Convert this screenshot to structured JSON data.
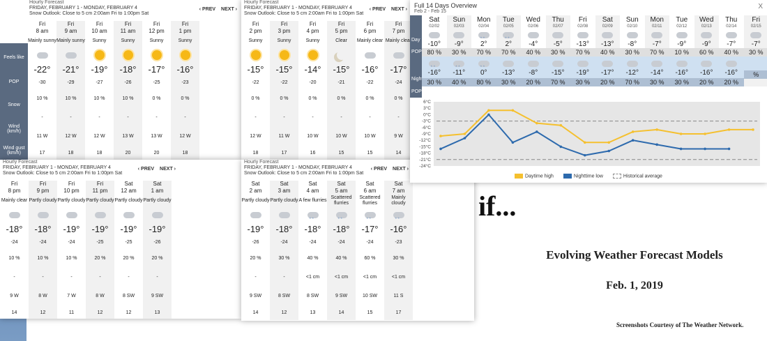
{
  "hourly_panels": [
    {
      "title": "Hourly Forecast",
      "range": "FRIDAY, FEBRUARY 1 - MONDAY, FEBRUARY 4",
      "outlook": "Snow Outlook: Close to 5 cm 2:00am Fri to 1:00pm Sat",
      "prev": "PREV",
      "next": "NEXT",
      "show_labels": true,
      "labels": [
        "Feels like",
        "POP",
        "Snow",
        "Wind (km/h)",
        "Wind gust (km/h)"
      ],
      "columns": [
        {
          "day": "Fri",
          "hour": "8 am",
          "cond": "Mainly sunny",
          "icon": "sun-cloud-icon",
          "temp": "-22°",
          "feels": "-30",
          "pop": "10 %",
          "snow": "-",
          "wind": "11 W",
          "gust": "17"
        },
        {
          "day": "Fri",
          "hour": "9 am",
          "cond": "Mainly sunny",
          "icon": "sun-cloud-icon",
          "temp": "-21°",
          "feels": "-29",
          "pop": "10 %",
          "snow": "-",
          "wind": "12 W",
          "gust": "18"
        },
        {
          "day": "Fri",
          "hour": "10 am",
          "cond": "Sunny",
          "icon": "sun-icon",
          "temp": "-19°",
          "feels": "-27",
          "pop": "10 %",
          "snow": "-",
          "wind": "12 W",
          "gust": "18"
        },
        {
          "day": "Fri",
          "hour": "11 am",
          "cond": "Sunny",
          "icon": "sun-icon",
          "temp": "-18°",
          "feels": "-26",
          "pop": "10 %",
          "snow": "-",
          "wind": "13 W",
          "gust": "20"
        },
        {
          "day": "Fri",
          "hour": "12 pm",
          "cond": "Sunny",
          "icon": "sun-icon",
          "temp": "-17°",
          "feels": "-25",
          "pop": "0 %",
          "snow": "-",
          "wind": "13 W",
          "gust": "20"
        },
        {
          "day": "Fri",
          "hour": "1 pm",
          "cond": "Sunny",
          "icon": "sun-icon",
          "temp": "-16°",
          "feels": "-23",
          "pop": "0 %",
          "snow": "-",
          "wind": "12 W",
          "gust": "18"
        }
      ]
    },
    {
      "title": "Hourly Forecast",
      "range": "FRIDAY, FEBRUARY 1 - MONDAY, FEBRUARY 4",
      "outlook": "Snow Outlook: Close to 5 cm 2:00am Fri to 1:00pm Sat",
      "prev": "PREV",
      "next": "NEXT",
      "show_labels": false,
      "labels": [],
      "columns": [
        {
          "day": "Fri",
          "hour": "2 pm",
          "cond": "Sunny",
          "icon": "sun-icon",
          "temp": "-15°",
          "feels": "-22",
          "pop": "0 %",
          "snow": "-",
          "wind": "12 W",
          "gust": "18"
        },
        {
          "day": "Fri",
          "hour": "3 pm",
          "cond": "Sunny",
          "icon": "sun-icon",
          "temp": "-15°",
          "feels": "-22",
          "pop": "0 %",
          "snow": "-",
          "wind": "11 W",
          "gust": "17"
        },
        {
          "day": "Fri",
          "hour": "4 pm",
          "cond": "Sunny",
          "icon": "sun-icon",
          "temp": "-14°",
          "feels": "-20",
          "pop": "0 %",
          "snow": "-",
          "wind": "10 W",
          "gust": "16"
        },
        {
          "day": "Fri",
          "hour": "5 pm",
          "cond": "Clear",
          "icon": "moon-icon",
          "temp": "-15°",
          "feels": "-21",
          "pop": "0 %",
          "snow": "-",
          "wind": "10 W",
          "gust": "15"
        },
        {
          "day": "Fri",
          "hour": "6 pm",
          "cond": "Mainly clear",
          "icon": "moon-cloud-icon",
          "temp": "-16°",
          "feels": "-22",
          "pop": "0 %",
          "snow": "-",
          "wind": "10 W",
          "gust": "15"
        },
        {
          "day": "Fri",
          "hour": "7 pm",
          "cond": "Mainly clear",
          "icon": "moon-cloud-icon",
          "temp": "-17°",
          "feels": "-24",
          "pop": "0 %",
          "snow": "-",
          "wind": "9 W",
          "gust": "14"
        }
      ]
    },
    {
      "title": "Hourly Forecast",
      "range": "FRIDAY, FEBRUARY 1 - MONDAY, FEBRUARY 4",
      "outlook": "Snow Outlook: Close to 5 cm 2:00am Fri to 1:00pm Sat",
      "prev": "PREV",
      "next": "NEXT",
      "show_labels": false,
      "labels": [],
      "columns": [
        {
          "day": "Fri",
          "hour": "8 pm",
          "cond": "Mainly clear",
          "icon": "moon-cloud-icon",
          "temp": "-18°",
          "feels": "-24",
          "pop": "10 %",
          "snow": "-",
          "wind": "9 W",
          "gust": "14"
        },
        {
          "day": "Fri",
          "hour": "9 pm",
          "cond": "Partly cloudy",
          "icon": "moon-cloud-icon",
          "temp": "-18°",
          "feels": "-24",
          "pop": "10 %",
          "snow": "-",
          "wind": "8 W",
          "gust": "12"
        },
        {
          "day": "Fri",
          "hour": "10 pm",
          "cond": "Partly cloudy",
          "icon": "moon-cloud-icon",
          "temp": "-19°",
          "feels": "-24",
          "pop": "10 %",
          "snow": "-",
          "wind": "7 W",
          "gust": "11"
        },
        {
          "day": "Fri",
          "hour": "11 pm",
          "cond": "Partly cloudy",
          "icon": "moon-cloud-icon",
          "temp": "-19°",
          "feels": "-25",
          "pop": "20 %",
          "snow": "-",
          "wind": "8 W",
          "gust": "12"
        },
        {
          "day": "Sat",
          "hour": "12 am",
          "cond": "Partly cloudy",
          "icon": "moon-cloud-icon",
          "temp": "-19°",
          "feels": "-25",
          "pop": "20 %",
          "snow": "-",
          "wind": "8 SW",
          "gust": "12"
        },
        {
          "day": "Sat",
          "hour": "1 am",
          "cond": "Partly cloudy",
          "icon": "moon-cloud-icon",
          "temp": "-19°",
          "feels": "-26",
          "pop": "20 %",
          "snow": "-",
          "wind": "9 SW",
          "gust": "13"
        }
      ]
    },
    {
      "title": "Hourly Forecast",
      "range": "FRIDAY, FEBRUARY 1 - MONDAY, FEBRUARY 4",
      "outlook": "Snow Outlook: Close to 5 cm 2:00am Fri to 1:00pm Sat",
      "prev": "PREV",
      "next": "NEXT",
      "show_labels": false,
      "labels": [],
      "columns": [
        {
          "day": "Sat",
          "hour": "2 am",
          "cond": "Partly cloudy",
          "icon": "moon-cloud-icon",
          "temp": "-19°",
          "feels": "-26",
          "pop": "20 %",
          "snow": "-",
          "wind": "9 SW",
          "gust": "14"
        },
        {
          "day": "Sat",
          "hour": "3 am",
          "cond": "Partly cloudy",
          "icon": "moon-cloud-icon",
          "temp": "-18°",
          "feels": "-24",
          "pop": "30 %",
          "snow": "-",
          "wind": "8 SW",
          "gust": "12"
        },
        {
          "day": "Sat",
          "hour": "4 am",
          "cond": "A few flurries",
          "icon": "snow-cloud-icon",
          "temp": "-18°",
          "feels": "-24",
          "pop": "40 %",
          "snow": "<1 cm",
          "wind": "8 SW",
          "gust": "13"
        },
        {
          "day": "Sat",
          "hour": "5 am",
          "cond": "Scattered flurries",
          "icon": "snow-cloud-icon",
          "temp": "-18°",
          "feels": "-24",
          "pop": "40 %",
          "snow": "<1 cm",
          "wind": "9 SW",
          "gust": "14"
        },
        {
          "day": "Sat",
          "hour": "6 am",
          "cond": "Scattered flurries",
          "icon": "snow-cloud-icon",
          "temp": "-17°",
          "feels": "-24",
          "pop": "60 %",
          "snow": "<1 cm",
          "wind": "10 SW",
          "gust": "15"
        },
        {
          "day": "Sat",
          "hour": "7 am",
          "cond": "Mainly cloudy",
          "icon": "snow-cloud-icon",
          "temp": "-16°",
          "feels": "-23",
          "pop": "30 %",
          "snow": "<1 cm",
          "wind": "11 S",
          "gust": "17"
        }
      ]
    }
  ],
  "overview": {
    "title": "Full 14 Days Overview",
    "range": "Feb 2 - Feb 15",
    "close": "X",
    "side_day": "Day",
    "side_pop": "POP",
    "side_night": "Night",
    "side_npop": "POP",
    "days": [
      {
        "name": "Sat",
        "date": "02/02",
        "day_icon": "cloud-icon",
        "day_temp": "-10°",
        "day_pop": "80 %",
        "night_icon": "snow-cloud-icon",
        "night_temp": "-16°",
        "night_pop": "30 %"
      },
      {
        "name": "Sun",
        "date": "02/03",
        "day_icon": "sun-cloud-icon",
        "day_temp": "-9°",
        "day_pop": "30 %",
        "night_icon": "snow-cloud-icon",
        "night_temp": "-11°",
        "night_pop": "40 %"
      },
      {
        "name": "Mon",
        "date": "02/04",
        "day_icon": "snow-cloud-icon",
        "day_temp": "2°",
        "day_pop": "70 %",
        "night_icon": "snow-cloud-icon",
        "night_temp": "0°",
        "night_pop": "80 %"
      },
      {
        "name": "Tue",
        "date": "02/05",
        "day_icon": "snow-cloud-icon",
        "day_temp": "2°",
        "day_pop": "70 %",
        "night_icon": "cloud-icon",
        "night_temp": "-13°",
        "night_pop": "30 %"
      },
      {
        "name": "Wed",
        "date": "02/06",
        "day_icon": "cloud-icon",
        "day_temp": "-4°",
        "day_pop": "40 %",
        "night_icon": "cloud-icon",
        "night_temp": "-8°",
        "night_pop": "20 %"
      },
      {
        "name": "Thu",
        "date": "02/07",
        "day_icon": "sun-cloud-icon",
        "day_temp": "-5°",
        "day_pop": "30 %",
        "night_icon": "cloud-icon",
        "night_temp": "-15°",
        "night_pop": "70 %"
      },
      {
        "name": "Fri",
        "date": "02/08",
        "day_icon": "cloud-icon",
        "day_temp": "-13°",
        "day_pop": "70 %",
        "night_icon": "cloud-icon",
        "night_temp": "-19°",
        "night_pop": "30 %"
      },
      {
        "name": "Sat",
        "date": "02/09",
        "day_icon": "sun-cloud-icon",
        "day_temp": "-13°",
        "day_pop": "40 %",
        "night_icon": "cloud-icon",
        "night_temp": "-17°",
        "night_pop": "20 %"
      },
      {
        "name": "Sun",
        "date": "02/10",
        "day_icon": "cloud-icon",
        "day_temp": "-8°",
        "day_pop": "30 %",
        "night_icon": "cloud-icon",
        "night_temp": "-12°",
        "night_pop": "70 %"
      },
      {
        "name": "Mon",
        "date": "02/11",
        "day_icon": "cloud-icon",
        "day_temp": "-7°",
        "day_pop": "70 %",
        "night_icon": "cloud-icon",
        "night_temp": "-14°",
        "night_pop": "30 %"
      },
      {
        "name": "Tue",
        "date": "02/12",
        "day_icon": "sun-cloud-icon",
        "day_temp": "-9°",
        "day_pop": "10 %",
        "night_icon": "cloud-icon",
        "night_temp": "-16°",
        "night_pop": "30 %"
      },
      {
        "name": "Wed",
        "date": "02/13",
        "day_icon": "cloud-icon",
        "day_temp": "-9°",
        "day_pop": "60 %",
        "night_icon": "cloud-icon",
        "night_temp": "-16°",
        "night_pop": "20 %"
      },
      {
        "name": "Thu",
        "date": "02/14",
        "day_icon": "cloud-icon",
        "day_temp": "-7°",
        "day_pop": "40 %",
        "night_icon": "cloud-icon",
        "night_temp": "-16°",
        "night_pop": "20 %"
      },
      {
        "name": "Fri",
        "date": "02/15",
        "day_icon": "cloud-icon",
        "day_temp": "-7°",
        "day_pop": "30 %",
        "night_icon": "",
        "night_temp": "",
        "night_pop": "%"
      }
    ],
    "chart_data": {
      "type": "line",
      "x": [
        "02/02",
        "02/03",
        "02/04",
        "02/05",
        "02/06",
        "02/07",
        "02/08",
        "02/09",
        "02/10",
        "02/11",
        "02/12",
        "02/13",
        "02/14",
        "02/15"
      ],
      "series": [
        {
          "name": "Daytime high",
          "color": "#f5c02e",
          "values": [
            -10,
            -9,
            2,
            2,
            -4,
            -5,
            -13,
            -13,
            -8,
            -7,
            -9,
            -9,
            -7,
            -7
          ]
        },
        {
          "name": "Nighttime low",
          "color": "#2d6aad",
          "values": [
            -16,
            -11,
            0,
            -13,
            -8,
            -15,
            -19,
            -17,
            -12,
            -14,
            -16,
            -16,
            -16,
            null
          ]
        }
      ],
      "historical_average_label": "Historical average",
      "historical_average_values": [
        -3,
        -21
      ],
      "yticks": [
        "6°C",
        "3°C",
        "0°C",
        "-3°C",
        "-6°C",
        "-9°C",
        "-12°C",
        "-15°C",
        "-18°C",
        "-21°C",
        "-24°C"
      ],
      "ylim": [
        -24,
        6
      ]
    }
  },
  "slide": {
    "if_text": "if...",
    "title": "Evolving Weather Forecast Models",
    "date": "Feb. 1, 2019",
    "credit": "Screenshots Courtesy of The Weather Network."
  }
}
